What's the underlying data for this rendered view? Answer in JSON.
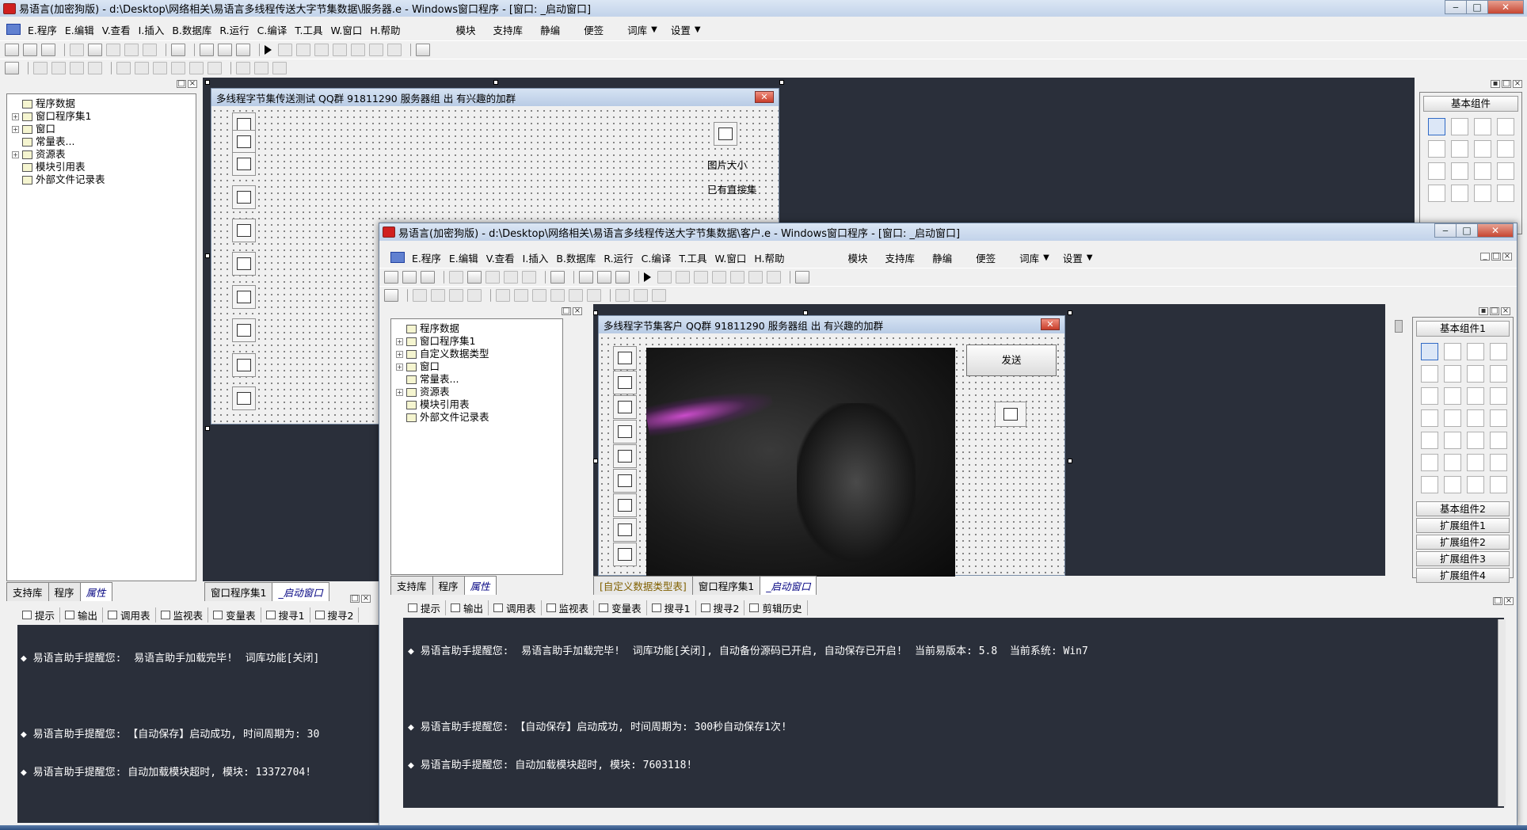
{
  "back_window": {
    "title": "易语言(加密狗版) - d:\\Desktop\\网络相关\\易语言多线程传送大字节集数据\\服务器.e - Windows窗口程序 - [窗口: _启动窗口]",
    "menu": [
      "E.程序",
      "E.编辑",
      "V.查看",
      "I.插入",
      "B.数据库",
      "R.运行",
      "C.编译",
      "T.工具",
      "W.窗口",
      "H.帮助"
    ],
    "menu_right": [
      "模块",
      "支持库",
      "静编",
      "便签",
      "词库",
      "设置"
    ],
    "tree_root": "程序数据",
    "tree_items": [
      {
        "label": "窗口程序集1",
        "expandable": true
      },
      {
        "label": "窗口",
        "expandable": true
      },
      {
        "label": "常量表...",
        "expandable": false
      },
      {
        "label": "资源表",
        "expandable": true
      },
      {
        "label": "模块引用表",
        "expandable": false
      },
      {
        "label": "外部文件记录表",
        "expandable": false
      }
    ],
    "left_tabs": [
      "支持库",
      "程序",
      "属性"
    ],
    "doc_tabs": [
      "窗口程序集1",
      "_启动窗口"
    ],
    "form_title": "多线程字节集传送测试 QQ群 91811290 服务器组 出 有兴趣的加群",
    "form_labels": [
      "图片大小",
      "已有直接集"
    ],
    "output_tabs": [
      "提示",
      "输出",
      "调用表",
      "监视表",
      "变量表",
      "搜寻1",
      "搜寻2"
    ],
    "output_lines": [
      "◆ 易语言助手提醒您:  易语言助手加载完毕!  词库功能[关闭]",
      "",
      "◆ 易语言助手提醒您: 【自动保存】启动成功, 时间周期为: 30",
      "◆ 易语言助手提醒您: 自动加载模块超时, 模块: 13372704!"
    ],
    "right_panel_title": "基本组件"
  },
  "front_window": {
    "title": "易语言(加密狗版) - d:\\Desktop\\网络相关\\易语言多线程传送大字节集数据\\客户.e - Windows窗口程序 - [窗口: _启动窗口]",
    "menu": [
      "E.程序",
      "E.编辑",
      "V.查看",
      "I.插入",
      "B.数据库",
      "R.运行",
      "C.编译",
      "T.工具",
      "W.窗口",
      "H.帮助"
    ],
    "menu_right": [
      "模块",
      "支持库",
      "静编",
      "便签",
      "词库",
      "设置"
    ],
    "tree_root": "程序数据",
    "tree_items": [
      {
        "label": "窗口程序集1",
        "expandable": true
      },
      {
        "label": "自定义数据类型",
        "expandable": true
      },
      {
        "label": "窗口",
        "expandable": true
      },
      {
        "label": "常量表...",
        "expandable": false
      },
      {
        "label": "资源表",
        "expandable": true
      },
      {
        "label": "模块引用表",
        "expandable": false
      },
      {
        "label": "外部文件记录表",
        "expandable": false
      }
    ],
    "left_tabs": [
      "支持库",
      "程序",
      "属性"
    ],
    "doc_tabs": [
      "[自定义数据类型表]",
      "窗口程序集1",
      "_启动窗口"
    ],
    "form_title": "多线程字节集客户 QQ群 91811290 服务器组 出 有兴趣的加群",
    "send_button": "发送",
    "output_tabs": [
      "提示",
      "输出",
      "调用表",
      "监视表",
      "变量表",
      "搜寻1",
      "搜寻2",
      "剪辑历史"
    ],
    "output_lines": [
      "◆ 易语言助手提醒您:  易语言助手加载完毕!  词库功能[关闭], 自动备份源码已开启, 自动保存已开启!  当前易版本: 5.8  当前系统: Win7",
      "",
      "◆ 易语言助手提醒您: 【自动保存】启动成功, 时间周期为: 300秒自动保存1次!",
      "◆ 易语言助手提醒您: 自动加载模块超时, 模块: 7603118!"
    ],
    "right_panel_title": "基本组件1",
    "right_panel_sections": [
      "基本组件2",
      "扩展组件1",
      "扩展组件2",
      "扩展组件3",
      "扩展组件4"
    ]
  }
}
